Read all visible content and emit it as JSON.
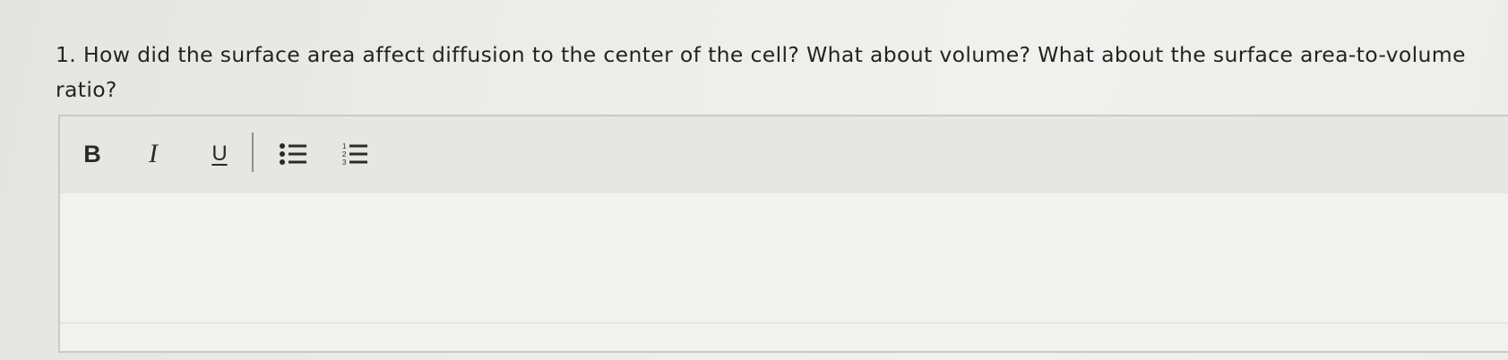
{
  "question": {
    "text": "1. How did the surface area affect diffusion to the center of the cell? What about volume? What about the surface area-to-volume ratio?"
  },
  "editor": {
    "toolbar": {
      "bold": {
        "label": "B",
        "icon": "bold-icon"
      },
      "italic": {
        "label": "I",
        "icon": "italic-icon"
      },
      "underline": {
        "label": "U",
        "icon": "underline-icon"
      },
      "bullet_list": {
        "icon": "bulleted-list-icon"
      },
      "numbered_list": {
        "icon": "numbered-list-icon"
      }
    },
    "content": ""
  }
}
